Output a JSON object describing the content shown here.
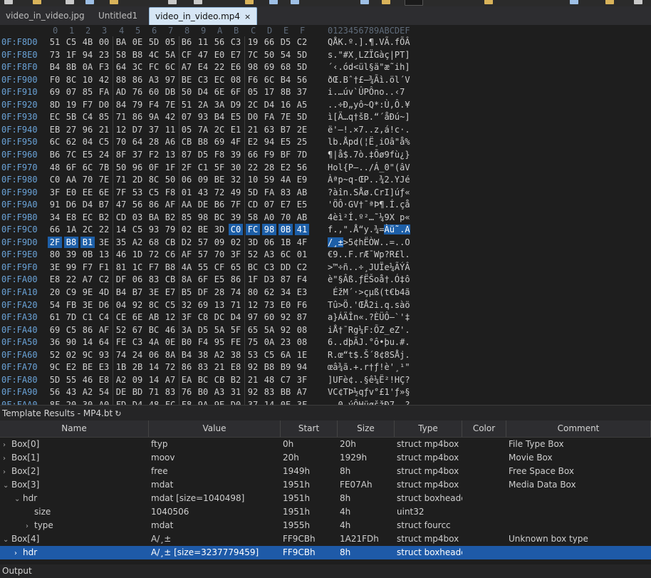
{
  "tabs": [
    {
      "label": "video_in_video.jpg",
      "active": false
    },
    {
      "label": "Untitled1",
      "active": false
    },
    {
      "label": "video_in_video.mp4",
      "active": true,
      "close": "×"
    }
  ],
  "hex": {
    "col_headers": [
      "0",
      "1",
      "2",
      "3",
      "4",
      "5",
      "6",
      "7",
      "8",
      "9",
      "A",
      "B",
      "C",
      "D",
      "E",
      "F"
    ],
    "ascii_header": "0123456789ABCDEF",
    "rows": [
      {
        "addr": "0F:F8D0",
        "bytes": [
          "51",
          "C5",
          "4B",
          "00",
          "BA",
          "0E",
          "5D",
          "05",
          "B6",
          "11",
          "56",
          "C3",
          "19",
          "66",
          "D5",
          "C2"
        ],
        "ascii": "QÅK.º.].¶.VÃ.fÕÂ"
      },
      {
        "addr": "0F:F8E0",
        "bytes": [
          "73",
          "1F",
          "94",
          "23",
          "58",
          "B8",
          "4C",
          "5A",
          "CF",
          "47",
          "E0",
          "E7",
          "7C",
          "50",
          "54",
          "5D"
        ],
        "ascii": "s.\"#X¸LZÏGàç|PT]"
      },
      {
        "addr": "0F:F8F0",
        "bytes": [
          "B4",
          "8B",
          "0A",
          "F3",
          "64",
          "3C",
          "FC",
          "6C",
          "A7",
          "E4",
          "22",
          "E6",
          "98",
          "69",
          "68",
          "5D"
        ],
        "ascii": "´‹.ód<ül§ä\"æ˜ih]"
      },
      {
        "addr": "0F:F900",
        "bytes": [
          "F0",
          "8C",
          "10",
          "42",
          "88",
          "86",
          "A3",
          "97",
          "BE",
          "C3",
          "EC",
          "08",
          "F6",
          "6C",
          "B4",
          "56"
        ],
        "ascii": "ðŒ.Bˆ†£—¾Ãì.öl´V"
      },
      {
        "addr": "0F:F910",
        "bytes": [
          "69",
          "07",
          "85",
          "FA",
          "AD",
          "76",
          "60",
          "DB",
          "50",
          "D4",
          "6E",
          "6F",
          "05",
          "17",
          "8B",
          "37"
        ],
        "ascii": "i.…ú­v`ÛPÔno..‹7"
      },
      {
        "addr": "0F:F920",
        "bytes": [
          "8D",
          "19",
          "F7",
          "D0",
          "84",
          "79",
          "F4",
          "7E",
          "51",
          "2A",
          "3A",
          "D9",
          "2C",
          "D4",
          "16",
          "A5"
        ],
        "ascii": "..÷Ð„yô~Q*:Ù,Ô.¥"
      },
      {
        "addr": "0F:F930",
        "bytes": [
          "EC",
          "5B",
          "C4",
          "85",
          "71",
          "86",
          "9A",
          "42",
          "07",
          "93",
          "B4",
          "E5",
          "D0",
          "FA",
          "7E",
          "5D"
        ],
        "ascii": "ì[Ä…q†šB.“´åÐú~]"
      },
      {
        "addr": "0F:F940",
        "bytes": [
          "EB",
          "27",
          "96",
          "21",
          "12",
          "D7",
          "37",
          "11",
          "05",
          "7A",
          "2C",
          "E1",
          "21",
          "63",
          "B7",
          "2E"
        ],
        "ascii": "ë'–!.×7..z,á!c·."
      },
      {
        "addr": "0F:F950",
        "bytes": [
          "6C",
          "62",
          "04",
          "C5",
          "70",
          "64",
          "28",
          "A6",
          "CB",
          "B8",
          "69",
          "4F",
          "E2",
          "94",
          "E5",
          "25"
        ],
        "ascii": "lb.Åpd(¦Ë¸iOâ\"å%"
      },
      {
        "addr": "0F:F960",
        "bytes": [
          "B6",
          "7C",
          "E5",
          "24",
          "8F",
          "37",
          "F2",
          "13",
          "87",
          "D5",
          "F8",
          "39",
          "66",
          "F9",
          "BF",
          "7D"
        ],
        "ascii": "¶|å$.7ò.‡Õø9fù¿}"
      },
      {
        "addr": "0F:F970",
        "bytes": [
          "48",
          "6F",
          "6C",
          "7B",
          "50",
          "96",
          "0F",
          "1F",
          "2F",
          "C1",
          "5F",
          "30",
          "22",
          "28",
          "E2",
          "56"
        ],
        "ascii": "Hol{P–../Á_0\"(âV"
      },
      {
        "addr": "0F:F980",
        "bytes": [
          "C0",
          "AA",
          "70",
          "7E",
          "71",
          "2D",
          "8C",
          "50",
          "06",
          "09",
          "BE",
          "32",
          "10",
          "59",
          "4A",
          "E9"
        ],
        "ascii": "Àªp~q-ŒP..¾2.YJé"
      },
      {
        "addr": "0F:F990",
        "bytes": [
          "3F",
          "E0",
          "EE",
          "6E",
          "7F",
          "53",
          "C5",
          "F8",
          "01",
          "43",
          "72",
          "49",
          "5D",
          "FA",
          "83",
          "AB"
        ],
        "ascii": "?àîn.SÅø.CrI]úƒ«"
      },
      {
        "addr": "0F:F9A0",
        "bytes": [
          "91",
          "D6",
          "D4",
          "B7",
          "47",
          "56",
          "86",
          "AF",
          "AA",
          "DE",
          "B6",
          "7F",
          "CD",
          "07",
          "E7",
          "E5"
        ],
        "ascii": "'ÖÔ·GV†¯ªÞ¶.Í.çå"
      },
      {
        "addr": "0F:F9B0",
        "bytes": [
          "34",
          "E8",
          "EC",
          "B2",
          "CD",
          "03",
          "BA",
          "B2",
          "85",
          "98",
          "BC",
          "39",
          "58",
          "A0",
          "70",
          "AB"
        ],
        "ascii": "4èì²Í.º²…˜¼9X p«"
      },
      {
        "addr": "0F:F9C0",
        "bytes": [
          "66",
          "1A",
          "2C",
          "22",
          "14",
          "C5",
          "93",
          "79",
          "02",
          "BE",
          "3D",
          "C0",
          "FC",
          "98",
          "0B",
          "41"
        ],
        "ascii": "f.,\".Å“y.¾=Àü˜.A",
        "sel_from": 11
      },
      {
        "addr": "0F:F9D0",
        "bytes": [
          "2F",
          "B8",
          "B1",
          "3E",
          "35",
          "A2",
          "68",
          "CB",
          "D2",
          "57",
          "09",
          "02",
          "3D",
          "06",
          "1B",
          "4F"
        ],
        "ascii": "/¸±>5¢hËÒW..=..O",
        "sel_to": 2
      },
      {
        "addr": "0F:F9E0",
        "bytes": [
          "80",
          "39",
          "0B",
          "13",
          "46",
          "1D",
          "72",
          "C6",
          "AF",
          "57",
          "70",
          "3F",
          "52",
          "A3",
          "6C",
          "01"
        ],
        "ascii": "€9..F.rÆ¯Wp?R£l."
      },
      {
        "addr": "0F:F9F0",
        "bytes": [
          "3E",
          "99",
          "F7",
          "F1",
          "81",
          "1C",
          "F7",
          "B8",
          "4A",
          "55",
          "CF",
          "65",
          "BC",
          "C3",
          "DD",
          "C2"
        ],
        "ascii": ">™÷ñ..÷¸JUÏe¼ÃÝÂ"
      },
      {
        "addr": "0F:FA00",
        "bytes": [
          "E8",
          "22",
          "A7",
          "C2",
          "DF",
          "06",
          "83",
          "CB",
          "8A",
          "6F",
          "E5",
          "86",
          "1F",
          "D3",
          "87",
          "F4"
        ],
        "ascii": "è\"§Âß.ƒËŠoå†.Ó‡ô"
      },
      {
        "addr": "0F:FA10",
        "bytes": [
          "20",
          "C9",
          "9E",
          "4D",
          "B4",
          "B7",
          "3E",
          "E7",
          "B5",
          "DF",
          "28",
          "74",
          "80",
          "62",
          "34",
          "E3"
        ],
        "ascii": " ÉžM´·>çµß(t€b4ã"
      },
      {
        "addr": "0F:FA20",
        "bytes": [
          "54",
          "FB",
          "3E",
          "D6",
          "04",
          "92",
          "8C",
          "C5",
          "32",
          "69",
          "13",
          "71",
          "12",
          "73",
          "E0",
          "F6"
        ],
        "ascii": "Tû>Ö.'ŒÅ2i.q.sàö"
      },
      {
        "addr": "0F:FA30",
        "bytes": [
          "61",
          "7D",
          "C1",
          "C4",
          "CE",
          "6E",
          "AB",
          "12",
          "3F",
          "C8",
          "DC",
          "D4",
          "97",
          "60",
          "92",
          "87"
        ],
        "ascii": "a}ÁÄÎn«.?ÈÜÔ—`'‡"
      },
      {
        "addr": "0F:FA40",
        "bytes": [
          "69",
          "C5",
          "86",
          "AF",
          "52",
          "67",
          "BC",
          "46",
          "3A",
          "D5",
          "5A",
          "5F",
          "65",
          "5A",
          "92",
          "08"
        ],
        "ascii": "iÅ†¯Rg¼F:ÕZ_eZ'."
      },
      {
        "addr": "0F:FA50",
        "bytes": [
          "36",
          "90",
          "14",
          "64",
          "FE",
          "C3",
          "4A",
          "0E",
          "B0",
          "F4",
          "95",
          "FE",
          "75",
          "0A",
          "23",
          "08"
        ],
        "ascii": "6..dþÃJ.°ô•þu.#."
      },
      {
        "addr": "0F:FA60",
        "bytes": [
          "52",
          "02",
          "9C",
          "93",
          "74",
          "24",
          "06",
          "8A",
          "B4",
          "38",
          "A2",
          "38",
          "53",
          "C5",
          "6A",
          "1E"
        ],
        "ascii": "R.œ“t$.Š´8¢8SÅj."
      },
      {
        "addr": "0F:FA70",
        "bytes": [
          "9C",
          "E2",
          "BE",
          "E3",
          "1B",
          "2B",
          "14",
          "72",
          "86",
          "83",
          "21",
          "E8",
          "92",
          "B8",
          "B9",
          "94"
        ],
        "ascii": "œâ¾ã.+.r†ƒ!è'¸¹\""
      },
      {
        "addr": "0F:FA80",
        "bytes": [
          "5D",
          "55",
          "46",
          "E8",
          "A2",
          "09",
          "14",
          "A7",
          "EA",
          "BC",
          "CB",
          "B2",
          "21",
          "48",
          "C7",
          "3F"
        ],
        "ascii": "]UFè¢..§ê¼Ë²!HÇ?"
      },
      {
        "addr": "0F:FA90",
        "bytes": [
          "56",
          "43",
          "A2",
          "54",
          "DE",
          "BD",
          "71",
          "83",
          "76",
          "B0",
          "A3",
          "31",
          "92",
          "83",
          "BB",
          "A7"
        ],
        "ascii": "VC¢TÞ½qƒv°£1'ƒ»§"
      },
      {
        "addr": "0F:FAA0",
        "bytes": [
          "8F",
          "20",
          "30",
          "A0",
          "FD",
          "D4",
          "48",
          "FC",
          "F8",
          "9A",
          "9E",
          "D0",
          "37",
          "14",
          "0E",
          "3F"
        ],
        "ascii": ". 0 ýÔHüøšžÐ7..?"
      },
      {
        "addr": "0F:FAB0",
        "bytes": [
          "8E",
          "A7",
          "43",
          "A8",
          "C9",
          "87",
          "7C",
          "73",
          "75",
          "96",
          "8E",
          "0D",
          "7A",
          "18",
          "A6",
          "EF"
        ],
        "ascii": "Ž§C¨É‡|su–Ž.z.¦ï"
      }
    ]
  },
  "template": {
    "title": "Template Results - MP4.bt",
    "refresh_icon": "↻",
    "columns": [
      "Name",
      "Value",
      "Start",
      "Size",
      "Type",
      "Color",
      "Comment"
    ],
    "rows": [
      {
        "indent": 0,
        "exp": "›",
        "name": "Box[0]",
        "value": "ftyp",
        "start": "0h",
        "size": "20h",
        "type": "struct mp4box",
        "color": "",
        "comment": "File Type Box",
        "selected": false
      },
      {
        "indent": 0,
        "exp": "›",
        "name": "Box[1]",
        "value": "moov",
        "start": "20h",
        "size": "1929h",
        "type": "struct mp4box",
        "color": "",
        "comment": "Movie Box",
        "selected": false
      },
      {
        "indent": 0,
        "exp": "›",
        "name": "Box[2]",
        "value": "free",
        "start": "1949h",
        "size": "8h",
        "type": "struct mp4box",
        "color": "",
        "comment": "Free Space Box",
        "selected": false
      },
      {
        "indent": 0,
        "exp": "⌄",
        "name": "Box[3]",
        "value": "mdat",
        "start": "1951h",
        "size": "FE07Ah",
        "type": "struct mp4box",
        "color": "",
        "comment": "Media Data Box",
        "selected": false
      },
      {
        "indent": 1,
        "exp": "⌄",
        "name": "hdr",
        "value": "mdat [size=1040498]",
        "start": "1951h",
        "size": "8h",
        "type": "struct boxheader",
        "color": "",
        "comment": "",
        "selected": false
      },
      {
        "indent": 2,
        "exp": "",
        "name": "size",
        "value": "1040506",
        "start": "1951h",
        "size": "4h",
        "type": "uint32",
        "color": "",
        "comment": "",
        "selected": false
      },
      {
        "indent": 2,
        "exp": "›",
        "name": "type",
        "value": "mdat",
        "start": "1955h",
        "size": "4h",
        "type": "struct fourcc",
        "color": "",
        "comment": "",
        "selected": false
      },
      {
        "indent": 0,
        "exp": "⌄",
        "name": "Box[4]",
        "value": "A/¸±",
        "start": "FF9CBh",
        "size": "1A21FDh",
        "type": "struct mp4box",
        "color": "",
        "comment": "Unknown box type",
        "selected": false
      },
      {
        "indent": 1,
        "exp": "›",
        "name": "hdr",
        "value": "A/¸± [size=3237779459]",
        "start": "FF9CBh",
        "size": "8h",
        "type": "struct boxheader",
        "color": "",
        "comment": "",
        "selected": true
      }
    ]
  },
  "output": {
    "label": "Output"
  }
}
